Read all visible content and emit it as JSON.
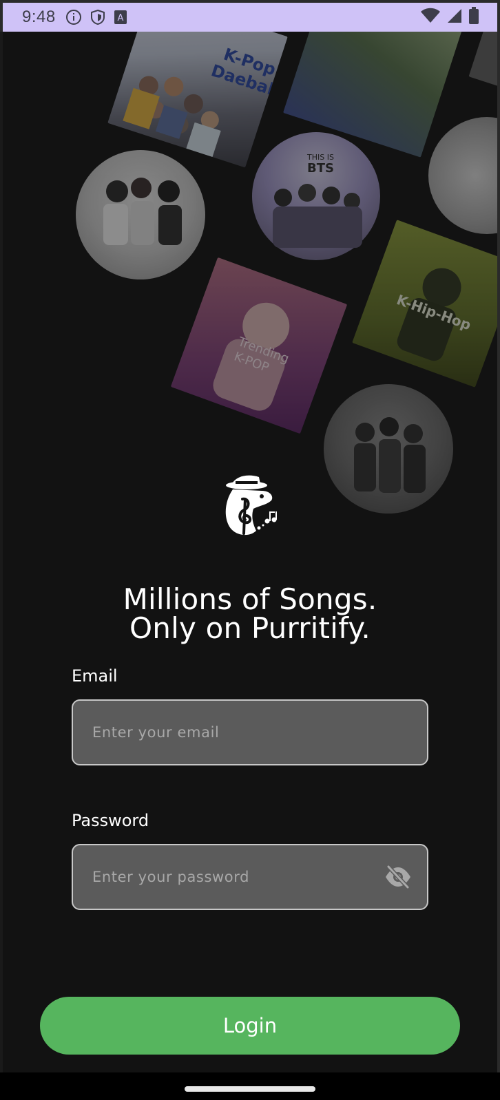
{
  "status_bar": {
    "time": "9:48",
    "icons": [
      "info-icon",
      "shield-icon",
      "font-a-icon",
      "wifi-icon",
      "cell-signal-icon",
      "battery-icon"
    ]
  },
  "collage": {
    "items": [
      {
        "name": "album-art-kpop-daebak",
        "text": "K-Pop\nDaebak"
      },
      {
        "name": "album-art-green-forest",
        "text": ""
      },
      {
        "name": "album-art-top-right",
        "text": ""
      },
      {
        "name": "artist-circle-girl-group",
        "text": ""
      },
      {
        "name": "artist-circle-bts",
        "text": "THIS IS\nBTS"
      },
      {
        "name": "artist-circle-right-edge",
        "text": ""
      },
      {
        "name": "playlist-k-hip-hop",
        "text": "K-Hip-Hop"
      },
      {
        "name": "playlist-trending-kpop",
        "text": "Trending\nK-POP"
      },
      {
        "name": "artist-circle-bottom",
        "text": ""
      }
    ]
  },
  "logo": {
    "icon": "cat-music-logo-icon"
  },
  "headline": {
    "line1": "Millions of Songs.",
    "line2": "Only on Purritify."
  },
  "form": {
    "email": {
      "label": "Email",
      "placeholder": "Enter your email",
      "value": ""
    },
    "password": {
      "label": "Password",
      "placeholder": "Enter your password",
      "value": "",
      "toggle_icon": "eye-off-icon"
    }
  },
  "login_button": {
    "label": "Login"
  },
  "colors": {
    "background": "#121212",
    "status_bar": "#cfc2f7",
    "accent_green": "#56b55e",
    "field_bg": "#5b5b5b",
    "field_border": "#c8c8c8"
  }
}
